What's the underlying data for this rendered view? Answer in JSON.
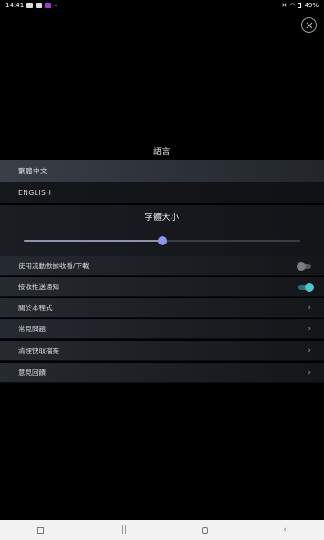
{
  "status_bar": {
    "time": "14:41",
    "battery": "49%"
  },
  "language_section": {
    "title": "語言",
    "options": [
      {
        "label": "繁體中文",
        "selected": true
      },
      {
        "label": "ENGLISH",
        "selected": false
      }
    ]
  },
  "font_size": {
    "title": "字體大小",
    "slider_value": 0.5
  },
  "settings": [
    {
      "label": "使用流動數據收看/下載",
      "control": "toggle",
      "on": false
    },
    {
      "label": "接收推送通知",
      "control": "toggle",
      "on": true
    },
    {
      "label": "關於本程式",
      "control": "chevron"
    },
    {
      "label": "常見問題",
      "control": "chevron"
    },
    {
      "label": "清理快取檔案",
      "control": "chevron"
    },
    {
      "label": "意見回饋",
      "control": "chevron"
    }
  ],
  "colors": {
    "accent_toggle": "#4fc6cf",
    "slider_thumb": "#8b98e8"
  }
}
